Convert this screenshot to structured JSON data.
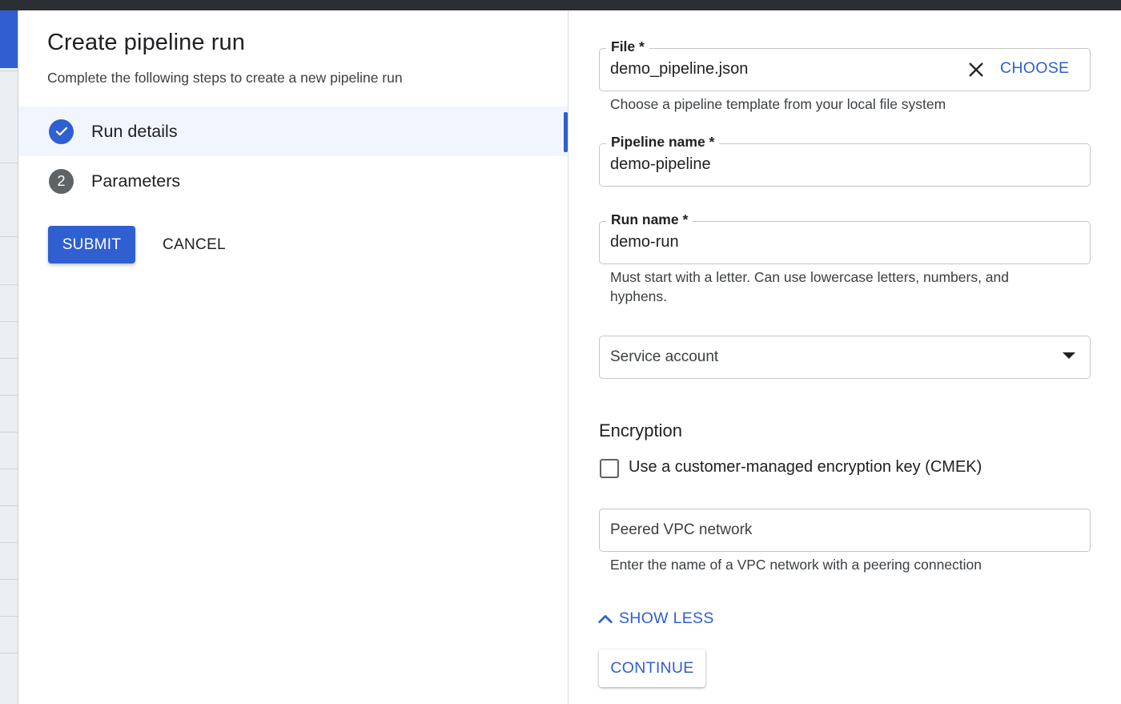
{
  "dialog": {
    "title": "Create pipeline run",
    "subtitle": "Complete the following steps to create a new pipeline run"
  },
  "steps": [
    {
      "number": "",
      "label": "Run details",
      "state": "completed",
      "icon": "check-circle-icon"
    },
    {
      "number": "2",
      "label": "Parameters",
      "state": "pending"
    }
  ],
  "actions": {
    "submit_label": "SUBMIT",
    "cancel_label": "CANCEL"
  },
  "form": {
    "file": {
      "label": "File *",
      "value": "demo_pipeline.json",
      "clear_icon": "close-icon",
      "choose_label": "CHOOSE",
      "hint": "Choose a pipeline template from your local file system"
    },
    "pipeline_name": {
      "label": "Pipeline name *",
      "value": "demo-pipeline"
    },
    "run_name": {
      "label": "Run name *",
      "value": "demo-run",
      "hint": "Must start with a letter. Can use lowercase letters, numbers, and hyphens."
    },
    "service_account": {
      "placeholder": "Service account",
      "icon": "dropdown-arrow-icon"
    },
    "encryption": {
      "title": "Encryption",
      "cmek_label": "Use a customer-managed encryption key (CMEK)",
      "cmek_checked": false
    },
    "vpc_network": {
      "placeholder": "Peered VPC network",
      "hint": "Enter the name of a VPC network with a peering connection"
    },
    "show_less_label": "SHOW LESS",
    "continue_label": "CONTINUE"
  },
  "colors": {
    "accent": "#2f5fd0",
    "active_step_bg": "#f1f5fe",
    "text": "#202124",
    "border": "#c3c6ca"
  }
}
